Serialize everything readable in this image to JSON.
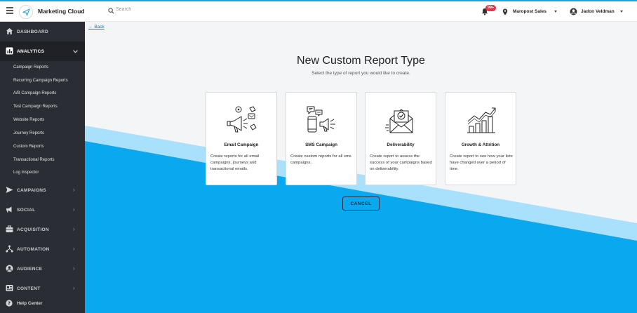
{
  "header": {
    "brand": "Marketing Cloud",
    "search_placeholder": "Search",
    "notification_count": "99+",
    "account_name": "Maropost Sales",
    "user_name": "Jadon Veldman"
  },
  "sidebar": {
    "top_items": [
      {
        "label": "DASHBOARD",
        "icon": "home-icon"
      },
      {
        "label": "ANALYTICS",
        "icon": "analytics-icon",
        "expanded": true
      }
    ],
    "analytics_sub_items": [
      "Campaign Reports",
      "Recurring Campaign Reports",
      "A/B Campaign Reports",
      "Test Campaign Reports",
      "Website Reports",
      "Journey Reports",
      "Custom Reports",
      "Transactional Reports",
      "Log Inspector"
    ],
    "bottom_items": [
      {
        "label": "CAMPAIGNS",
        "icon": "send-icon"
      },
      {
        "label": "SOCIAL",
        "icon": "megaphone-icon"
      },
      {
        "label": "ACQUISITION",
        "icon": "briefcase-icon"
      },
      {
        "label": "AUTOMATION",
        "icon": "flow-icon"
      },
      {
        "label": "AUDIENCE",
        "icon": "user-circle-icon"
      },
      {
        "label": "CONTENT",
        "icon": "content-icon"
      }
    ],
    "help_label": "Help Center"
  },
  "main": {
    "back_label": "Back",
    "title": "New Custom Report Type",
    "subtitle": "Select the type of report you would like to create.",
    "cards": [
      {
        "title": "Email Campaign",
        "description": "Create reports for all email campaigns, journeys and transactional emails.",
        "icon": "email-campaign-illustration"
      },
      {
        "title": "SMS Campaign",
        "description": "Create custom reports for all sms campaigns.",
        "icon": "sms-campaign-illustration"
      },
      {
        "title": "Deliverability",
        "description": "Create report to assess the success of your campaigns based on deliverability.",
        "icon": "deliverability-illustration"
      },
      {
        "title": "Growth & Attrition",
        "description": "Create report to see how your lists have changed over a period of time.",
        "icon": "growth-chart-illustration"
      }
    ],
    "cancel_label": "CANCEL"
  },
  "colors": {
    "accent": "#1ba1e6",
    "sidebar": "#2a2d33",
    "wave_primary": "#0aa8ef",
    "wave_light": "#a9e0fb",
    "badge": "#e5344b"
  }
}
